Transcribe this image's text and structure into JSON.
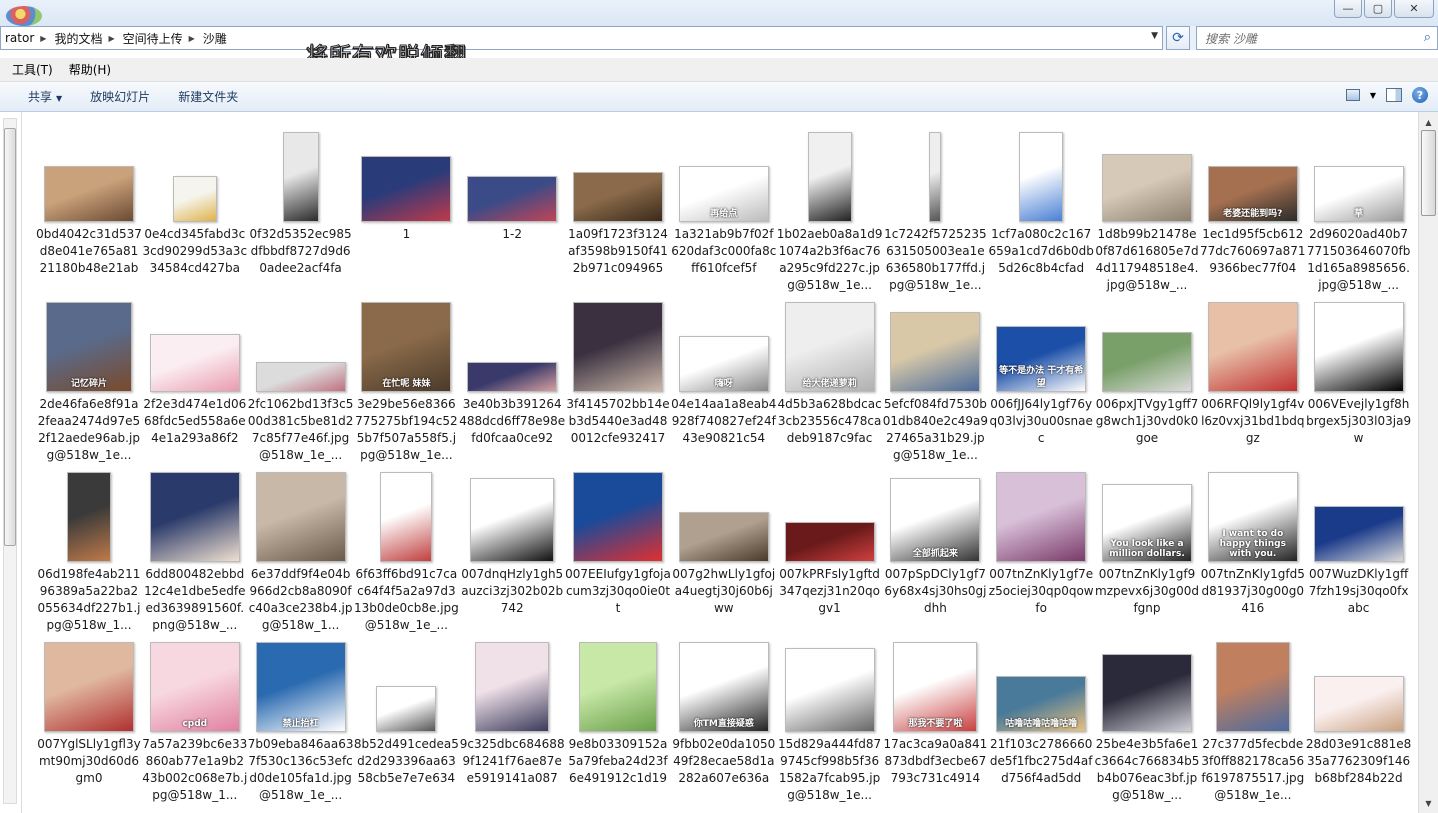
{
  "address": {
    "crumbs": [
      "rator",
      "我的文档",
      "空间待上传",
      "沙雕"
    ]
  },
  "search": {
    "placeholder": "搜索 沙雕"
  },
  "overlay_title": "将所有欢脱倾翻",
  "menu": {
    "tools": "工具(T)",
    "help": "帮助(H)"
  },
  "toolbar": {
    "share": "共享",
    "slideshow": "放映幻灯片",
    "new_folder": "新建文件夹"
  },
  "window": {
    "minimize": "—",
    "maximize": "▢",
    "close": "✕"
  },
  "files": [
    {
      "name": "0bd4042c31d537d8e041e765a8121180b48e21ab",
      "w": 90,
      "h": 56,
      "colors": [
        "#c9a17a",
        "#6b4a33"
      ]
    },
    {
      "name": "0e4cd345fabd3c3cd90299d53a3c34584cd427ba",
      "w": 44,
      "h": 46,
      "colors": [
        "#f5f5ee",
        "#e0b24a"
      ]
    },
    {
      "name": "0f32d5352ec985dfbbdf8727d9d60adee2acf4fa",
      "w": 36,
      "h": 90,
      "colors": [
        "#e8e8e8",
        "#2b2b2b"
      ]
    },
    {
      "name": "1",
      "w": 90,
      "h": 66,
      "colors": [
        "#2a3b7a",
        "#c0394a"
      ]
    },
    {
      "name": "1-2",
      "w": 90,
      "h": 46,
      "colors": [
        "#3a4b88",
        "#c34455"
      ]
    },
    {
      "name": "1a09f1723f3124af3598b9150f412b971c094965",
      "w": 90,
      "h": 50,
      "colors": [
        "#8a6a4a",
        "#3a2a1a"
      ]
    },
    {
      "name": "1a321ab9b7f02f620daf3c000fa8cff610fcef5f",
      "w": 90,
      "h": 56,
      "colors": [
        "#ffffff",
        "#bbbbbb"
      ],
      "text": "再给点"
    },
    {
      "name": "1b02aeb0a8a1d91074a2b3f6ac76a295c9fd227c.jpg@518w_1e...",
      "w": 44,
      "h": 90,
      "colors": [
        "#f0f0f0",
        "#222222"
      ]
    },
    {
      "name": "1c7242f5725235631505003ea1e636580b177ffd.jpg@518w_1e...",
      "w": 12,
      "h": 90,
      "colors": [
        "#eeeeee",
        "#555555"
      ]
    },
    {
      "name": "1cf7a080c2c167659a1cd7d6b0db5d26c8b4cfad",
      "w": 44,
      "h": 90,
      "colors": [
        "#ffffff",
        "#4a7fd4"
      ]
    },
    {
      "name": "1d8b99b21478e0f87d616805e7d4d117948518e4.jpg@518w_...",
      "w": 90,
      "h": 68,
      "colors": [
        "#d6c9b8",
        "#8d7f6e"
      ]
    },
    {
      "name": "1ec1d95f5cb61277dc760697a8719366bec77f04",
      "w": 90,
      "h": 56,
      "colors": [
        "#a57050",
        "#2b2b2b"
      ],
      "text": "老婆还能到吗?"
    },
    {
      "name": "2d96020ad40b7771503646070fb1d165a8985656.jpg@518w_...",
      "w": 90,
      "h": 56,
      "colors": [
        "#ffffff",
        "#999999"
      ],
      "text": "草"
    },
    {
      "name": "2de46fa6e8f91a2feaa2474d97e52f12aede96ab.jpg@518w_1e...",
      "w": 86,
      "h": 90,
      "colors": [
        "#5a6a8a",
        "#7a4a2a"
      ],
      "text": "记忆碎片"
    },
    {
      "name": "2f2e3d474e1d0668fdc5ed558a6e4e1a293a86f2",
      "w": 90,
      "h": 58,
      "colors": [
        "#fbeef2",
        "#e99bb0"
      ]
    },
    {
      "name": "2fc1062bd13f3c500d381c5be81d27c85f77e46f.jpg@518w_1e_...",
      "w": 90,
      "h": 30,
      "colors": [
        "#dcdcdc",
        "#c07080"
      ]
    },
    {
      "name": "3e29be56e8366775275bf194c525b7f507a558f5.jpg@518w_1e...",
      "w": 90,
      "h": 90,
      "colors": [
        "#8a6a4a",
        "#4a3a2a"
      ],
      "text": "在忙呢 妹妹"
    },
    {
      "name": "3e40b3b391264488dcd6ff78e98efd0fcaa0ce92",
      "w": 90,
      "h": 30,
      "colors": [
        "#3a3a6a",
        "#d8a0a0"
      ]
    },
    {
      "name": "3f4145702bb14eb3d5440e3ad480012cfe932417",
      "w": 90,
      "h": 90,
      "colors": [
        "#3a3040",
        "#c9b7a8"
      ]
    },
    {
      "name": "04e14aa1a8eab4928f740827ef24f43e90821c54",
      "w": 90,
      "h": 56,
      "colors": [
        "#ffffff",
        "#888888"
      ],
      "text": "嗨呀"
    },
    {
      "name": "4d5b3a628bdcac3cb23556c478cadeb9187c9fac",
      "w": 90,
      "h": 90,
      "colors": [
        "#eeeeee",
        "#b0b0b0"
      ],
      "text": "给大佬递萝莉"
    },
    {
      "name": "5efcf084fd7530b01db840e2c49a927465a31b29.jpg@518w_1e...",
      "w": 90,
      "h": 80,
      "colors": [
        "#d8c8a8",
        "#4a6a9a"
      ]
    },
    {
      "name": "006fJJ64ly1gf76yq03lvj30u00snaec",
      "w": 90,
      "h": 66,
      "colors": [
        "#1c4fa8",
        "#ffffff"
      ],
      "text": "等不是办法 干才有希望"
    },
    {
      "name": "006pxJTVgy1gff7g8wch1j30vd0k0goe",
      "w": 90,
      "h": 60,
      "colors": [
        "#7aa06a",
        "#dcdcdc"
      ]
    },
    {
      "name": "006RFQl9ly1gf4vl6z0vxj31bd1bdqgz",
      "w": 90,
      "h": 90,
      "colors": [
        "#e8c0a8",
        "#c03030"
      ]
    },
    {
      "name": "006VEvejly1gf8hbrgex5j303l03ja9w",
      "w": 90,
      "h": 90,
      "colors": [
        "#ffffff",
        "#000000"
      ]
    },
    {
      "name": "06d198fe4ab21196389a5a22ba2055634df227b1.jpg@518w_1...",
      "w": 44,
      "h": 90,
      "colors": [
        "#3a3a3a",
        "#c07a4a"
      ]
    },
    {
      "name": "6dd800482ebbd12c4e1dbe5edfeed3639891560f.png@518w_...",
      "w": 90,
      "h": 90,
      "colors": [
        "#2a3a6a",
        "#f0e0d0"
      ]
    },
    {
      "name": "6e37ddf9f4e04b966d2cb8a8090fc40a3ce238b4.jpg@518w_1...",
      "w": 90,
      "h": 90,
      "colors": [
        "#c8b8a8",
        "#6a5a4a"
      ]
    },
    {
      "name": "6f63ff6bd91c7cac64f4f5a2a97d313b0de0cb8e.jpg@518w_1e_...",
      "w": 52,
      "h": 90,
      "colors": [
        "#ffffff",
        "#c04040"
      ]
    },
    {
      "name": "007dnqHzly1gh5auzci3zj302b02b742",
      "w": 84,
      "h": 84,
      "colors": [
        "#ffffff",
        "#111111"
      ]
    },
    {
      "name": "007EEIufgy1gfojacum3zj30qo0ie0tt",
      "w": 90,
      "h": 90,
      "colors": [
        "#1a4a9a",
        "#e03030"
      ]
    },
    {
      "name": "007g2hwLly1gfoja4uegtj30j60b6jww",
      "w": 90,
      "h": 50,
      "colors": [
        "#b0a090",
        "#4a3a2a"
      ]
    },
    {
      "name": "007kPRFsly1gftd347qezj31n20qogv1",
      "w": 90,
      "h": 40,
      "colors": [
        "#6a1a1a",
        "#d04040"
      ]
    },
    {
      "name": "007pSpDCly1gf76y68x4sj30hs0gjdhh",
      "w": 90,
      "h": 84,
      "colors": [
        "#ffffff",
        "#333333"
      ],
      "text": "全部抓起来"
    },
    {
      "name": "007tnZnKly1gf7ez5ociej30qp0qowfo",
      "w": 90,
      "h": 90,
      "colors": [
        "#d8c0d8",
        "#7a3a6a"
      ]
    },
    {
      "name": "007tnZnKly1gf9mzpevx6j30g00dfgnp",
      "w": 90,
      "h": 78,
      "colors": [
        "#ffffff",
        "#222222"
      ],
      "text": "You look like a million dollars."
    },
    {
      "name": "007tnZnKly1gfd5d81937j30g00g0416",
      "w": 90,
      "h": 90,
      "colors": [
        "#ffffff",
        "#222222"
      ],
      "text": "I want to do happy things with you."
    },
    {
      "name": "007WuzDKly1gff7fzh19sj30qo0fxabc",
      "w": 90,
      "h": 56,
      "colors": [
        "#1a3a8a",
        "#d8d8d8"
      ]
    },
    {
      "name": "007YglSLly1gfl3ymt90mj30d60d6gm0",
      "w": 90,
      "h": 90,
      "colors": [
        "#e0b8a0",
        "#b03030"
      ]
    },
    {
      "name": "7a57a239bc6e33860ab77e1a9b243b002c068e7b.jpg@518w_1...",
      "w": 90,
      "h": 90,
      "colors": [
        "#f8d8e0",
        "#e080a0"
      ],
      "text": "cpdd"
    },
    {
      "name": "7b09eba846aa637f530c136c53efcd0de105fa1d.jpg@518w_1e_...",
      "w": 90,
      "h": 90,
      "colors": [
        "#2a6ab0",
        "#ffffff"
      ],
      "text": "禁止抬杠"
    },
    {
      "name": "8b52d491cedea5d2d293396aa6358cb5e7e7e634",
      "w": 60,
      "h": 46,
      "colors": [
        "#ffffff",
        "#555555"
      ]
    },
    {
      "name": "9c325dbc6846889f1241f76ae87ee5919141a087",
      "w": 74,
      "h": 90,
      "colors": [
        "#f0e0e8",
        "#3a3a5a"
      ]
    },
    {
      "name": "9e8b03309152a5a79feba24d23f6e491912c1d19",
      "w": 78,
      "h": 90,
      "colors": [
        "#c8e8a8",
        "#6aa04a"
      ]
    },
    {
      "name": "9fbb02e0da105049f28ecae58d1a282a607e636a",
      "w": 90,
      "h": 90,
      "colors": [
        "#ffffff",
        "#222222"
      ],
      "text": "你TM直接疑惑"
    },
    {
      "name": "15d829a444fd879745cf998b5f361582a7fcab95.jpg@518w_1e...",
      "w": 90,
      "h": 84,
      "colors": [
        "#ffffff",
        "#666666"
      ]
    },
    {
      "name": "17ac3ca9a0a841873dbdf3ecbe67793c731c4914",
      "w": 84,
      "h": 90,
      "colors": [
        "#ffffff",
        "#c84040"
      ],
      "text": "那我不要了啦"
    },
    {
      "name": "21f103c2786660de5f1fbc275d4afd756f4ad5dd",
      "w": 90,
      "h": 56,
      "colors": [
        "#4a7a9a",
        "#e8c080"
      ],
      "text": "咕噜咕噜咕噜咕噜"
    },
    {
      "name": "25be4e3b5fa6e1c3664c766834b5b4b076eac3bf.jpg@518w_...",
      "w": 90,
      "h": 78,
      "colors": [
        "#2a2a3a",
        "#d0d0d8"
      ]
    },
    {
      "name": "27c377d5fecbde3f0ff882178ca56f6197875517.jpg@518w_1e...",
      "w": 74,
      "h": 90,
      "colors": [
        "#c08060",
        "#4a6aa0"
      ]
    },
    {
      "name": "28d03e91c881e835a7762309f146b68bf284b22d",
      "w": 90,
      "h": 56,
      "colors": [
        "#fbf0f0",
        "#c8a080"
      ]
    }
  ]
}
